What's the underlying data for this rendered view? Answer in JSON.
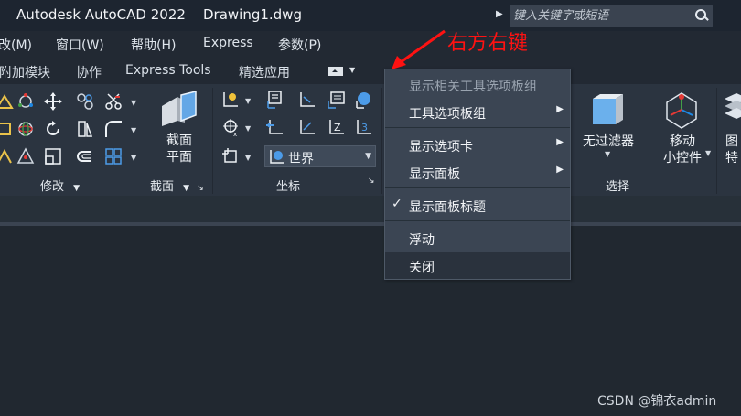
{
  "window": {
    "title": "Autodesk AutoCAD 2022    Drawing1.dwg"
  },
  "search": {
    "placeholder": "键入关键字或短语"
  },
  "menubar": {
    "items": [
      "改(M)",
      "窗口(W)",
      "帮助(H)",
      "Express",
      "参数(P)"
    ]
  },
  "tabs": {
    "items": [
      "附加模块",
      "协作",
      "Express Tools",
      "精选应用"
    ]
  },
  "ribbon": {
    "panels": [
      {
        "label": "修改",
        "has_dropdown": true
      },
      {
        "label": "截面",
        "has_dropdown": true,
        "has_launcher": true
      },
      {
        "label": "坐标",
        "has_launcher": true
      },
      {
        "label": "选择"
      }
    ],
    "section_plane_label_1": "截面",
    "section_plane_label_2": "平面",
    "ucs_dropdown_value": "世界",
    "no_filter_label": "无过滤器",
    "move_gizmo_label_1": "移动",
    "move_gizmo_label_2": "小控件",
    "partial_label_1": "图",
    "partial_label_2": "特"
  },
  "context_menu": {
    "items": [
      {
        "label": "显示相关工具选项板组",
        "disabled": true
      },
      {
        "label": "工具选项板组",
        "submenu": true
      },
      {
        "label": "显示选项卡",
        "submenu": true
      },
      {
        "label": "显示面板",
        "submenu": true
      },
      {
        "label": "显示面板标题",
        "checked": true
      },
      {
        "label": "浮动"
      },
      {
        "label": "关闭",
        "highlighted": true
      }
    ]
  },
  "annotation": {
    "text": "右方右键",
    "color": "#ff1212"
  },
  "watermark": {
    "text": "CSDN @锦衣admin"
  },
  "colors": {
    "titlebar": "#1d2530",
    "ribbon": "#2b3440",
    "menu_bg": "#3b4553",
    "menu_hover": "#2a323d"
  }
}
